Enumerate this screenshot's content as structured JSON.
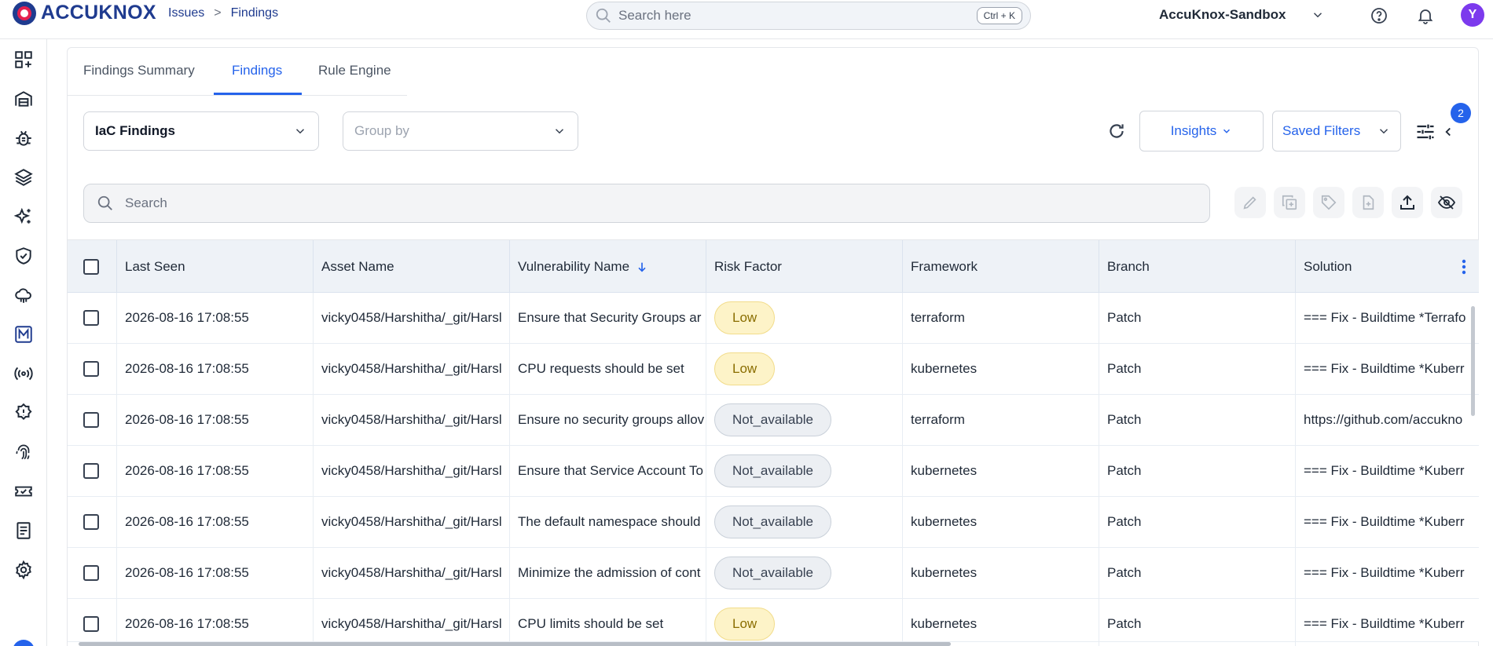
{
  "brand": {
    "name": "ACCUKNOX"
  },
  "breadcrumb": {
    "items": [
      "Issues",
      "Findings"
    ],
    "separator": ">"
  },
  "global_search": {
    "placeholder": "Search here",
    "shortcut": "Ctrl + K"
  },
  "header": {
    "org_name": "AccuKnox-Sandbox",
    "avatar_initial": "Y"
  },
  "sidebar": {
    "icons": [
      "dashboard-icon",
      "inventory-icon",
      "bug-icon",
      "layers-icon",
      "ai-sparkle-icon",
      "shield-check-icon",
      "cloud-icon",
      "m-badge-icon",
      "broadcast-icon",
      "gear-badge-icon",
      "fingerprint-icon",
      "ticket-icon",
      "report-icon",
      "settings-icon"
    ]
  },
  "tabs": [
    {
      "label": "Findings Summary",
      "active": false
    },
    {
      "label": "Findings",
      "active": true
    },
    {
      "label": "Rule Engine",
      "active": false
    }
  ],
  "toolbar": {
    "findings_type": "IaC Findings",
    "group_by_placeholder": "Group by",
    "insights_label": "Insights",
    "saved_filters_label": "Saved Filters",
    "filter_badge_count": "2"
  },
  "table_search": {
    "placeholder": "Search"
  },
  "table": {
    "columns": [
      "Last Seen",
      "Asset Name",
      "Vulnerability Name",
      "Risk Factor",
      "Framework",
      "Branch",
      "Solution"
    ],
    "rows": [
      {
        "last_seen": "2026-08-16 17:08:55",
        "asset": "vicky0458/Harshitha/_git/Harsl",
        "vuln": "Ensure that Security Groups ar",
        "risk": "Low",
        "framework": "terraform",
        "branch": "Patch",
        "solution": "=== Fix - Buildtime *Terrafo"
      },
      {
        "last_seen": "2026-08-16 17:08:55",
        "asset": "vicky0458/Harshitha/_git/Harsl",
        "vuln": "CPU requests should be set",
        "risk": "Low",
        "framework": "kubernetes",
        "branch": "Patch",
        "solution": "=== Fix - Buildtime *Kuberr"
      },
      {
        "last_seen": "2026-08-16 17:08:55",
        "asset": "vicky0458/Harshitha/_git/Harsl",
        "vuln": "Ensure no security groups allov",
        "risk": "Not_available",
        "framework": "terraform",
        "branch": "Patch",
        "solution": "https://github.com/accukno"
      },
      {
        "last_seen": "2026-08-16 17:08:55",
        "asset": "vicky0458/Harshitha/_git/Harsl",
        "vuln": "Ensure that Service Account To",
        "risk": "Not_available",
        "framework": "kubernetes",
        "branch": "Patch",
        "solution": "=== Fix - Buildtime *Kuberr"
      },
      {
        "last_seen": "2026-08-16 17:08:55",
        "asset": "vicky0458/Harshitha/_git/Harsl",
        "vuln": "The default namespace should",
        "risk": "Not_available",
        "framework": "kubernetes",
        "branch": "Patch",
        "solution": "=== Fix - Buildtime *Kuberr"
      },
      {
        "last_seen": "2026-08-16 17:08:55",
        "asset": "vicky0458/Harshitha/_git/Harsl",
        "vuln": "Minimize the admission of cont",
        "risk": "Not_available",
        "framework": "kubernetes",
        "branch": "Patch",
        "solution": "=== Fix - Buildtime *Kuberr"
      },
      {
        "last_seen": "2026-08-16 17:08:55",
        "asset": "vicky0458/Harshitha/_git/Harsl",
        "vuln": "CPU limits should be set",
        "risk": "Low",
        "framework": "kubernetes",
        "branch": "Patch",
        "solution": "=== Fix - Buildtime *Kuberr"
      }
    ]
  },
  "colors": {
    "accent": "#2563eb",
    "brand": "#1f3b8f",
    "low_pill": "#fdf3c8",
    "na_pill": "#eceff3"
  }
}
